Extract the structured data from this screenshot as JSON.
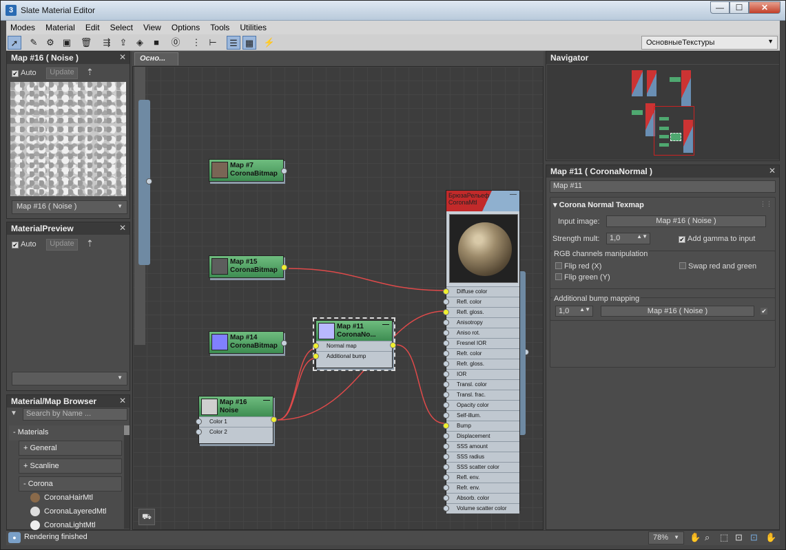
{
  "window": {
    "title": "Slate Material Editor",
    "app_icon": "3",
    "min": "—",
    "max": "☐",
    "close": "✕"
  },
  "menu": [
    "Modes",
    "Material",
    "Edit",
    "Select",
    "View",
    "Options",
    "Tools",
    "Utilities"
  ],
  "toolbar": {
    "view_select": "ОсновныеТекстуры"
  },
  "preview1": {
    "title": "Map #16  ( Noise )",
    "auto": "Auto",
    "update": "Update",
    "dropdown": "Map #16  ( Noise )"
  },
  "preview2": {
    "title": "MaterialPreview",
    "auto": "Auto",
    "update": "Update"
  },
  "canvas": {
    "tab": "Осно..."
  },
  "nodes": {
    "map7": {
      "l1": "Map #7",
      "l2": "CoronaBitmap"
    },
    "map15": {
      "l1": "Map #15",
      "l2": "CoronaBitmap"
    },
    "map14": {
      "l1": "Map #14",
      "l2": "CoronaBitmap"
    },
    "map11": {
      "l1": "Map #11",
      "l2": "CoronaNo...",
      "p1": "Normal map",
      "p2": "Additional bump"
    },
    "map16": {
      "l1": "Map #16",
      "l2": "Noise",
      "p1": "Color 1",
      "p2": "Color 2"
    },
    "mat": {
      "l1": "БрюзаРельеф",
      "l2": "CoronaMtl",
      "params": [
        "Diffuse color",
        "Refl. color",
        "Refl. gloss.",
        "Anisotropy",
        "Aniso rot.",
        "Fresnel IOR",
        "Refr. color",
        "Refr. gloss.",
        "IOR",
        "Transl. color",
        "Transl. frac.",
        "Opacity color",
        "Self-illum.",
        "Bump",
        "Displacement",
        "SSS amount",
        "SSS radius",
        "SSS scatter color",
        "Refl. env.",
        "Refr. env.",
        "Absorb. color",
        "Volume scatter color"
      ]
    }
  },
  "navigator": {
    "title": "Navigator"
  },
  "params": {
    "header": "Map #11  ( CoronaNormal )",
    "name_field": "Map #11",
    "rollout": "Corona Normal Texmap",
    "input_image_label": "Input image:",
    "input_image_value": "Map #16  ( Noise )",
    "strength_label": "Strength mult:",
    "strength_value": "1,0",
    "add_gamma": "Add gamma to input",
    "rgb_group": "RGB channels manipulation",
    "flip_red": "Flip red (X)",
    "flip_green": "Flip green (Y)",
    "swap": "Swap red and green",
    "bump_group": "Additional bump mapping",
    "bump_amount": "1,0",
    "bump_map": "Map #16  ( Noise )"
  },
  "browser": {
    "title": "Material/Map Browser",
    "search_placeholder": "Search by Name ...",
    "items": [
      "- Materials",
      "+ General",
      "+ Scanline",
      "- Corona"
    ],
    "subitems": [
      "CoronaHairMtl",
      "CoronaLayeredMtl",
      "CoronaLightMtl"
    ]
  },
  "status": {
    "text": "Rendering finished",
    "zoom": "78%"
  }
}
